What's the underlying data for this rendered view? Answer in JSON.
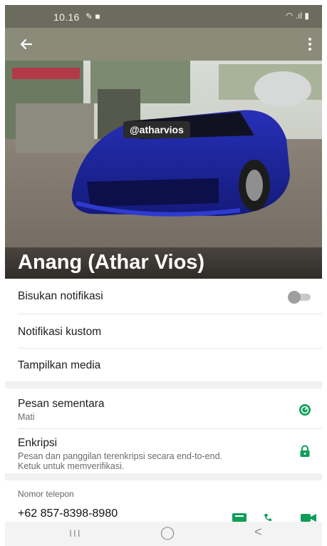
{
  "status_bar": {
    "time": "10.16",
    "left_icons": "✎ ■",
    "right_icons": "◠ .ıl ▮"
  },
  "app_bar": {
    "back_icon": "arrow-left",
    "more_icon": "more-vertical"
  },
  "profile": {
    "photo_tag": "@atharvios",
    "name": "Anang (Athar Vios)"
  },
  "settings": {
    "mute_label": "Bisukan notifikasi",
    "mute_enabled": false,
    "custom_notif_label": "Notifikasi kustom",
    "media_label": "Tampilkan media"
  },
  "privacy": {
    "disappearing_label": "Pesan sementara",
    "disappearing_value": "Mati",
    "encryption_label": "Enkripsi",
    "encryption_desc_1": "Pesan dan panggilan terenkripsi secara end-to-end.",
    "encryption_desc_2": "Ketuk untuk memverifikasi."
  },
  "phone_section": {
    "caption": "Nomor telepon",
    "number": "+62 857-8398-8980",
    "action_icons": [
      "message-icon",
      "phone-icon",
      "video-icon"
    ]
  },
  "nav": {
    "recent": "III",
    "home": "◯",
    "back": "<"
  },
  "colors": {
    "accent": "#0f9d58",
    "app_bar": "#8a8b79",
    "status_bar": "#6b6b5e"
  }
}
